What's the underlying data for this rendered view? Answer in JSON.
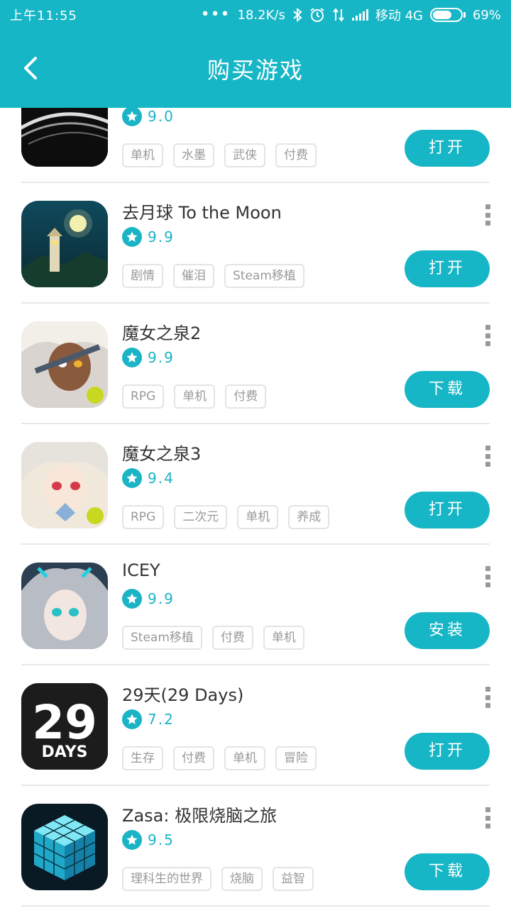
{
  "status_bar": {
    "time": "上午11:55",
    "dots": "•••",
    "speed": "18.2K/s",
    "carrier": "移动 4G",
    "battery": "69%",
    "battery_level": 0.69
  },
  "header": {
    "title": "购买游戏"
  },
  "colors": {
    "accent": "#16b6c6",
    "tag_border": "#e4e4e4"
  },
  "games": [
    {
      "name": "",
      "score": "9.0",
      "tags": [
        "单机",
        "水墨",
        "武侠",
        "付费"
      ],
      "action": "打开",
      "icon": "ink-brush-game-icon"
    },
    {
      "name": "去月球 To the Moon",
      "score": "9.9",
      "tags": [
        "剧情",
        "催泪",
        "Steam移植"
      ],
      "action": "打开",
      "icon": "lighthouse-moon-game-icon"
    },
    {
      "name": "魔女之泉2",
      "score": "9.9",
      "tags": [
        "RPG",
        "单机",
        "付费"
      ],
      "action": "下载",
      "icon": "anime-witch-game-icon"
    },
    {
      "name": "魔女之泉3",
      "score": "9.4",
      "tags": [
        "RPG",
        "二次元",
        "单机",
        "养成"
      ],
      "action": "打开",
      "icon": "anime-witch-game-icon"
    },
    {
      "name": "ICEY",
      "score": "9.9",
      "tags": [
        "Steam移植",
        "付费",
        "单机"
      ],
      "action": "安装",
      "icon": "icey-girl-game-icon"
    },
    {
      "name": "29天(29 Days)",
      "score": "7.2",
      "tags": [
        "生存",
        "付费",
        "单机",
        "冒险"
      ],
      "action": "打开",
      "icon": "29-days-game-icon",
      "icon_text": "29",
      "icon_sub": "DAYS"
    },
    {
      "name": "Zasa: 极限烧脑之旅",
      "score": "9.5",
      "tags": [
        "理科生的世界",
        "烧脑",
        "益智"
      ],
      "action": "下载",
      "icon": "cube-puzzle-game-icon"
    }
  ]
}
